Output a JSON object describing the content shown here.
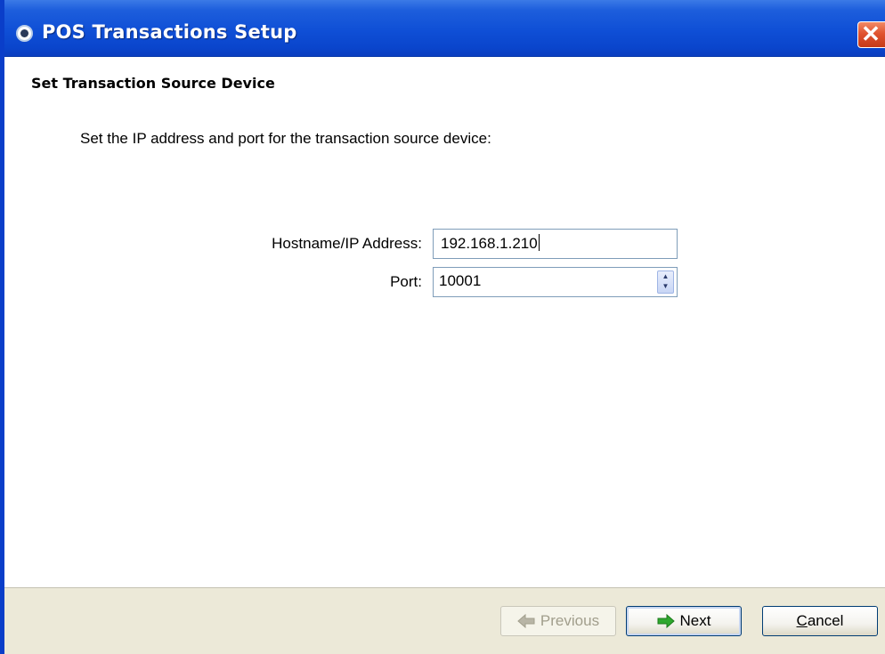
{
  "window": {
    "title": "POS Transactions Setup",
    "close_glyph": "✕"
  },
  "page": {
    "heading": "Set Transaction Source Device",
    "instruction": "Set the IP address and port for the transaction source device:"
  },
  "form": {
    "hostname_label": "Hostname/IP Address:",
    "hostname_value": "192.168.1.210",
    "port_label": "Port:",
    "port_value": "10001"
  },
  "buttons": {
    "previous": "Previous",
    "next": "Next",
    "cancel_mnemonic": "C",
    "cancel_rest": "ancel"
  },
  "icons": {
    "title": "info-circle-icon",
    "previous": "arrow-left-icon",
    "next": "arrow-right-icon",
    "spinner": "spinner-arrows-icon"
  },
  "colors": {
    "titlebar": "#0a45cc",
    "close": "#e0532f",
    "footer": "#ece9d8",
    "next_arrow": "#2fa82f"
  }
}
